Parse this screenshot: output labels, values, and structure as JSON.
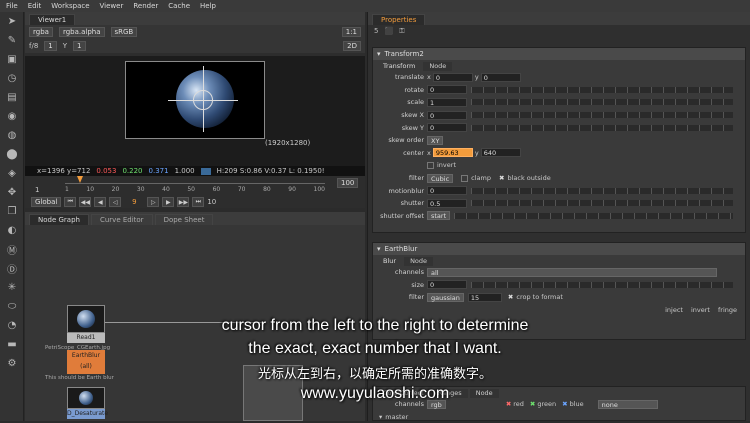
{
  "menu": [
    "File",
    "Edit",
    "Workspace",
    "Viewer",
    "Render",
    "Cache",
    "Help"
  ],
  "viewer": {
    "tab": "Viewer1",
    "channel1": "rgba",
    "channel2": "rgba.alpha",
    "colorspace": "sRGB",
    "zoom": "1:1",
    "frame_fraction": "f/8",
    "gain": "1",
    "y_label": "Y",
    "gamma": "1",
    "mode": "2D",
    "resolution": "(1920x1280)",
    "coords": "x=1396 y=712",
    "r": "0.053",
    "g": "0.220",
    "b": "0.371",
    "a": "1.000",
    "hsv": "H:209 S:0.86 V:0.37  L: 0.1950!",
    "timeline_start": "1",
    "timeline_end": "100",
    "ticks": [
      "1",
      "10",
      "20",
      "30",
      "40",
      "50",
      "60",
      "70",
      "80",
      "90",
      "100"
    ],
    "global": "Global",
    "frame": "9",
    "step": "10"
  },
  "panels": {
    "node_graph": "Node Graph",
    "curve_editor": "Curve Editor",
    "dope_sheet": "Dope Sheet",
    "properties": "Properties"
  },
  "nodes": {
    "read": "Read1",
    "read_file": "PetriScope_CGEarth.jpg",
    "blur": "EarthBlur",
    "blur_sub": "(all)",
    "blur_note": "This should be Earth blur",
    "bottom": "D_Desaturate"
  },
  "transform": {
    "title": "Transform2",
    "tabs": [
      "Transform",
      "Node"
    ],
    "translate_label": "translate",
    "translate_x": "0",
    "translate_y": "0",
    "rotate_label": "rotate",
    "rotate": "0",
    "scale_label": "scale",
    "scale": "1",
    "skewx_label": "skew X",
    "skewx": "0",
    "skewy_label": "skew Y",
    "skewy": "0",
    "skew_order_label": "skew order",
    "skew_order": "XY",
    "center_label": "center",
    "center_x": "959.63",
    "center_y": "640",
    "invert": "invert",
    "filter_label": "filter",
    "filter": "Cubic",
    "clamp": "clamp",
    "black_outside": "black outside",
    "motionblur_label": "motionblur",
    "motionblur": "0",
    "shutter_label": "shutter",
    "shutter": "0.5",
    "shutter_offset_label": "shutter offset",
    "shutter_offset": "start"
  },
  "blurnode": {
    "title": "EarthBlur",
    "tabs": [
      "Blur",
      "Node"
    ],
    "channels_label": "channels",
    "channels": "all",
    "size_label": "size",
    "size": "0",
    "filter_label": "filter",
    "filter": "gaussian",
    "quality": "15",
    "crop": "crop to format",
    "inject": "inject",
    "invert": "invert",
    "fringe": "fringe"
  },
  "colorcorrect": {
    "tabs": [
      "ColorCorrect",
      "Ranges",
      "Node"
    ],
    "channels_label": "channels",
    "channels": "rgb",
    "red": "red",
    "green": "green",
    "blue": "blue",
    "mask": "none",
    "section": "master"
  },
  "subtitles": {
    "line1": "cursor from the left to the right to determine",
    "line2": "the exact, exact number that I want.",
    "line3": "光标从左到右，以确定所需的准确数字。",
    "line4": "www.yuyulaoshi.com"
  }
}
